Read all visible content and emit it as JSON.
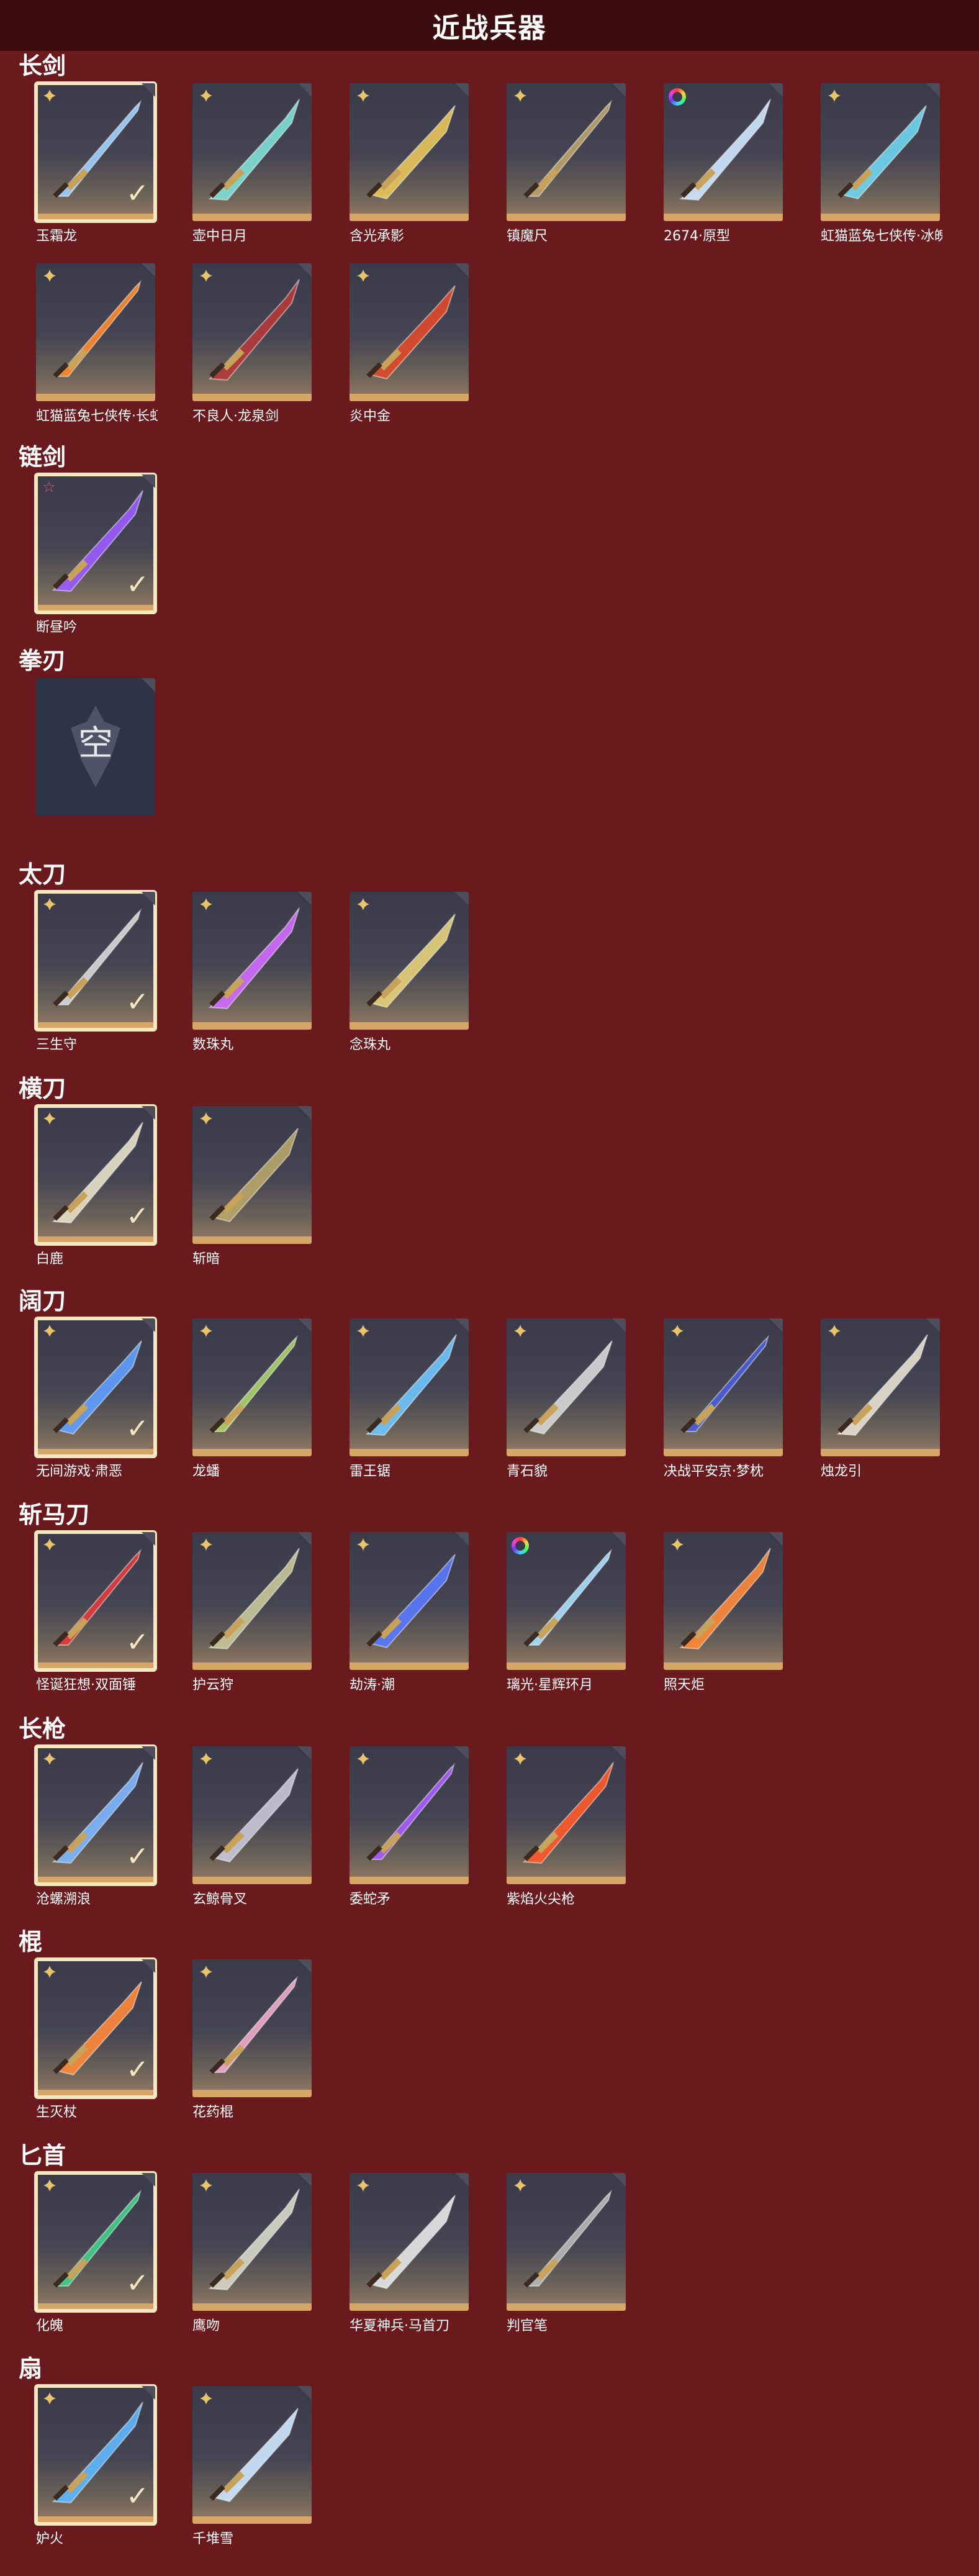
{
  "header": {
    "title": "近战兵器"
  },
  "categories": [
    {
      "key": "longsword",
      "title": "长剑",
      "items": [
        {
          "name": "玉霜龙",
          "badge": "flower",
          "selected": true,
          "color": "#9fd1ff"
        },
        {
          "name": "壶中日月",
          "badge": "flower",
          "selected": false,
          "color": "#7fe0d6"
        },
        {
          "name": "含光承影",
          "badge": "flower",
          "selected": false,
          "color": "#e9c65a"
        },
        {
          "name": "镇魔尺",
          "badge": "flower",
          "selected": false,
          "color": "#b9a46a"
        },
        {
          "name": "2674·原型",
          "badge": "rainbow",
          "selected": false,
          "color": "#cfe8ff"
        },
        {
          "name": "虹猫蓝兔七侠传·冰魄剑",
          "badge": "flower",
          "selected": false,
          "color": "#6fd6f0"
        },
        {
          "name": "虹猫蓝兔七侠传·长虹剑",
          "badge": "flower",
          "selected": false,
          "color": "#ff8a2a"
        },
        {
          "name": "不良人·龙泉剑",
          "badge": "flower",
          "selected": false,
          "color": "#b53a3a"
        },
        {
          "name": "炎中金",
          "badge": "flower",
          "selected": false,
          "color": "#e04a2a"
        }
      ]
    },
    {
      "key": "chainsword",
      "title": "链剑",
      "items": [
        {
          "name": "断昼吟",
          "badge": "star",
          "selected": true,
          "color": "#9b5cff"
        }
      ]
    },
    {
      "key": "fist",
      "title": "拳刃",
      "items": [
        {
          "name": "",
          "badge": "none",
          "selected": false,
          "empty": true,
          "empty_char": "空"
        }
      ]
    },
    {
      "key": "tachi",
      "title": "太刀",
      "items": [
        {
          "name": "三生守",
          "badge": "flower",
          "selected": true,
          "color": "#d8d8d8"
        },
        {
          "name": "数珠丸",
          "badge": "flower",
          "selected": false,
          "color": "#d06cff"
        },
        {
          "name": "念珠丸",
          "badge": "flower",
          "selected": false,
          "color": "#e6d27a"
        }
      ]
    },
    {
      "key": "hengdao",
      "title": "横刀",
      "items": [
        {
          "name": "白鹿",
          "badge": "flower",
          "selected": true,
          "color": "#e8e0c8"
        },
        {
          "name": "斩暗",
          "badge": "flower",
          "selected": false,
          "color": "#b8a66a"
        }
      ]
    },
    {
      "key": "kuodao",
      "title": "阔刀",
      "items": [
        {
          "name": "无间游戏·肃恶",
          "badge": "flower",
          "selected": true,
          "color": "#5fa0ff"
        },
        {
          "name": "龙蟠",
          "badge": "flower",
          "selected": false,
          "color": "#a8d26a"
        },
        {
          "name": "雷王锯",
          "badge": "flower",
          "selected": false,
          "color": "#6fc6ff"
        },
        {
          "name": "青石貌",
          "badge": "flower",
          "selected": false,
          "color": "#d8d8d8"
        },
        {
          "name": "决战平安京·梦枕",
          "badge": "flower",
          "selected": false,
          "color": "#4a5ed8"
        },
        {
          "name": "烛龙引",
          "badge": "flower",
          "selected": false,
          "color": "#e8e0d0"
        }
      ]
    },
    {
      "key": "zhanmadao",
      "title": "斩马刀",
      "items": [
        {
          "name": "怪诞狂想·双面锤",
          "badge": "flower",
          "selected": true,
          "color": "#e23a3a"
        },
        {
          "name": "护云狩",
          "badge": "flower",
          "selected": false,
          "color": "#c8c89a"
        },
        {
          "name": "劫涛·潮",
          "badge": "flower",
          "selected": false,
          "color": "#5a7aff"
        },
        {
          "name": "璃光·星辉环月",
          "badge": "rainbow",
          "selected": false,
          "color": "#a8e0ff"
        },
        {
          "name": "照天炬",
          "badge": "flower",
          "selected": false,
          "color": "#ff8a3a"
        }
      ]
    },
    {
      "key": "spear",
      "title": "长枪",
      "items": [
        {
          "name": "沧螺溯浪",
          "badge": "flower",
          "selected": true,
          "color": "#7fb8ff"
        },
        {
          "name": "玄鲸骨叉",
          "badge": "flower",
          "selected": false,
          "color": "#c8c8d8"
        },
        {
          "name": "委蛇矛",
          "badge": "flower",
          "selected": false,
          "color": "#a85cff"
        },
        {
          "name": "紫焰火尖枪",
          "badge": "flower",
          "selected": false,
          "color": "#ff5a2a"
        }
      ]
    },
    {
      "key": "staff",
      "title": "棍",
      "items": [
        {
          "name": "生灭杖",
          "badge": "flower",
          "selected": true,
          "color": "#ff8a3a"
        },
        {
          "name": "花药棍",
          "badge": "flower",
          "selected": false,
          "color": "#f0a8c8"
        }
      ]
    },
    {
      "key": "dagger",
      "title": "匕首",
      "items": [
        {
          "name": "化魄",
          "badge": "flower",
          "selected": true,
          "color": "#3fd08a"
        },
        {
          "name": "鹰吻",
          "badge": "flower",
          "selected": false,
          "color": "#d8d8c8"
        },
        {
          "name": "华夏神兵·马首刀",
          "badge": "flower",
          "selected": false,
          "color": "#e8e8e8"
        },
        {
          "name": "判官笔",
          "badge": "flower",
          "selected": false,
          "color": "#b8b8b8"
        }
      ]
    },
    {
      "key": "fan",
      "title": "扇",
      "items": [
        {
          "name": "妒火",
          "badge": "flower",
          "selected": true,
          "color": "#5fb8ff"
        },
        {
          "name": "千堆雪",
          "badge": "flower",
          "selected": false,
          "color": "#cfe8ff"
        }
      ]
    }
  ]
}
